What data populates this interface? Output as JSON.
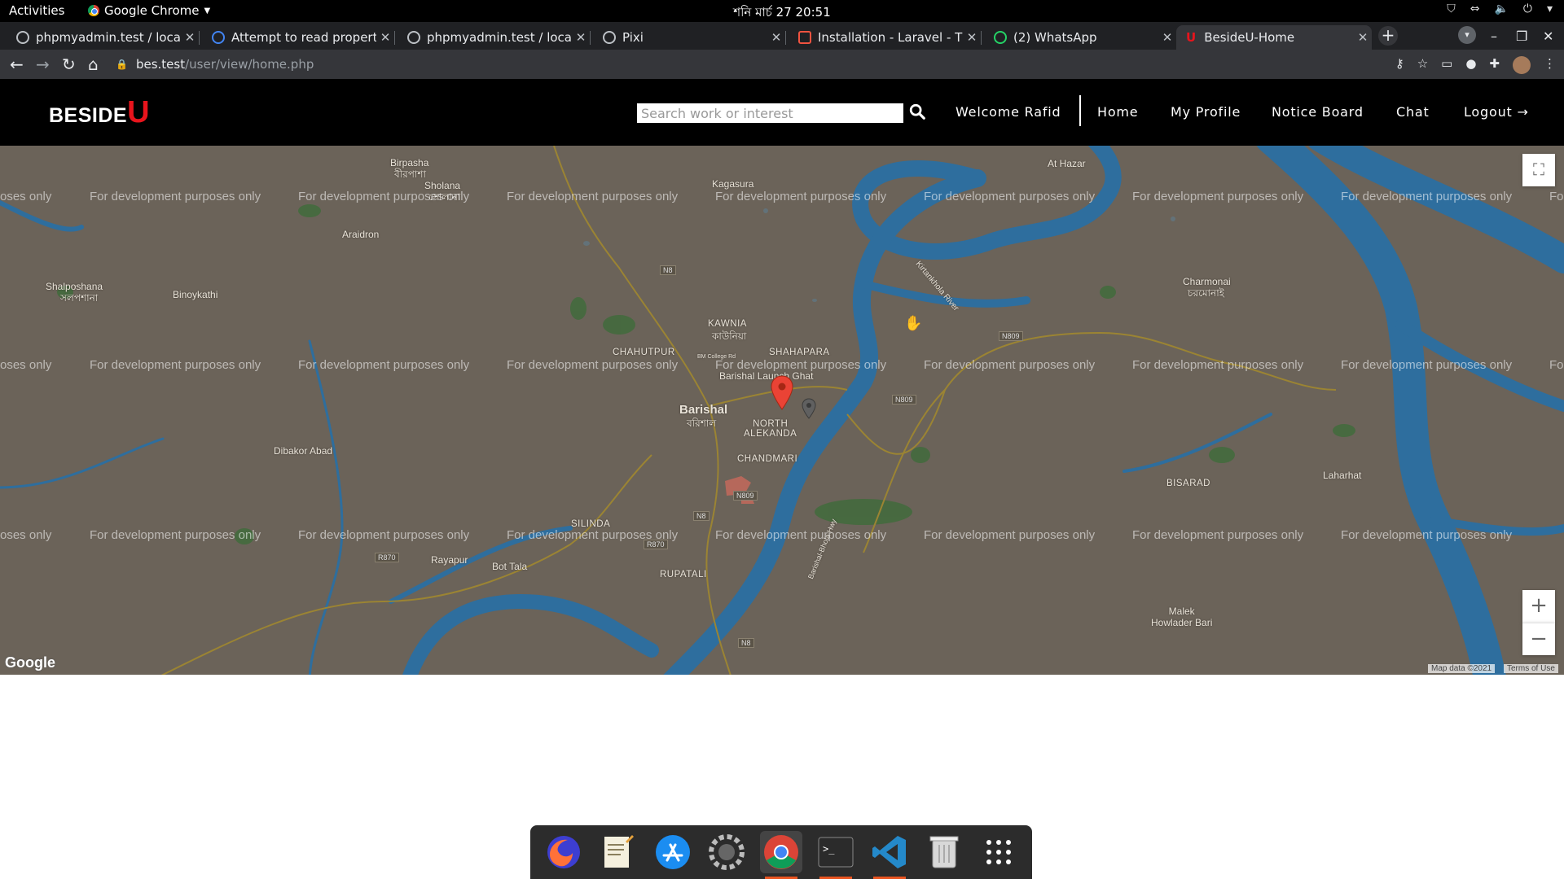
{
  "system_bar": {
    "activities": "Activities",
    "app_name": "Google Chrome",
    "clock": "শনি মার্চ 27  20:51"
  },
  "tabs": [
    {
      "title": "phpmyadmin.test / localh"
    },
    {
      "title": "Attempt to read property"
    },
    {
      "title": "phpmyadmin.test / localh"
    },
    {
      "title": "Pixi"
    },
    {
      "title": "Installation - Laravel - The"
    },
    {
      "title": "(2) WhatsApp"
    },
    {
      "title": "BesideU-Home"
    }
  ],
  "address_bar": {
    "host": "bes.test",
    "path": "/user/view/home.php"
  },
  "site": {
    "logo_text": "BESIDE",
    "logo_accent": "U",
    "search_placeholder": "Search work or interest",
    "welcome": "Welcome Rafid",
    "nav": {
      "home": "Home",
      "profile": "My Profile",
      "notice": "Notice Board",
      "chat": "Chat",
      "logout": "Logout →"
    }
  },
  "map": {
    "watermark": "For development purposes only",
    "watermark_partial_left": "oses only",
    "watermark_partial_right": "Fo",
    "places": {
      "birpasha": "Birpasha",
      "birpasha_bn": "বীরপাশা",
      "sholana": "Sholana",
      "sholana_bn": "সোলানা",
      "kagasura": "Kagasura",
      "araidron": "Araidron",
      "at_hazar": "At Hazar",
      "shalposhana": "Shalposhana",
      "shalposhana_bn": "সলপশানা",
      "binoykathi": "Binoykathi",
      "charmonai": "Charmonai",
      "charmonai_bn": "চরমোনাই",
      "kawnia": "KAWNIA",
      "kawnia_bn": "কাউনিয়া",
      "chahutpur": "CHAHUTPUR",
      "shahapara": "SHAHAPARA",
      "barishal_ghat": "Barishal Launch Ghat",
      "barishal": "Barishal",
      "barishal_bn": "বরিশাল",
      "north_alekanda": "NORTH\nALEKANDA",
      "chandmari": "CHANDMARI",
      "dibakar": "Dibakor Abad",
      "bisarad": "BISARAD",
      "laharhat": "Laharhat",
      "silinda": "SILINDA",
      "rayapur": "Rayapur",
      "bot_tala": "Bot Tala",
      "rupatali": "RUPATALI",
      "malek": "Malek\nHowlader Bari",
      "kirtankhola": "Kirtankhola River",
      "bm_college": "BM College Rd",
      "hwy": "Barishal-Bhola Hwy"
    },
    "road_shields": [
      "N8",
      "N809",
      "N809",
      "N809",
      "N8",
      "R870",
      "R870",
      "N8"
    ],
    "attribution": "Map data ©2021",
    "terms": "Terms of Use",
    "google": "Google"
  },
  "dock": [
    "firefox-icon",
    "text-editor-icon",
    "app-store-icon",
    "settings-icon",
    "chrome-icon",
    "terminal-icon",
    "vscode-icon",
    "trash-icon",
    "app-grid-icon"
  ]
}
